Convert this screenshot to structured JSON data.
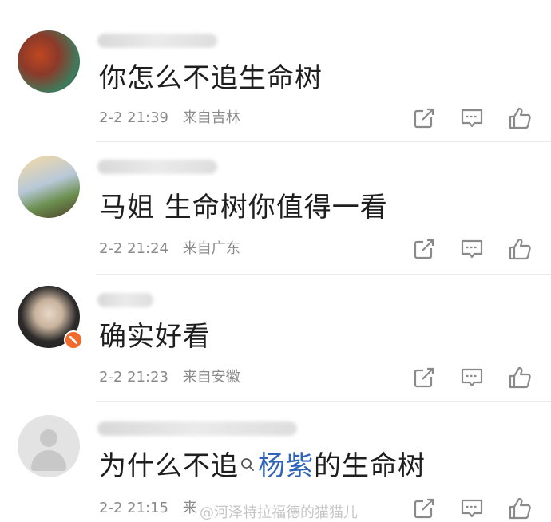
{
  "comments": [
    {
      "text": "你怎么不追生命树",
      "time": "2-2 21:39",
      "location": "来自吉林"
    },
    {
      "text": "马姐 生命树你值得一看",
      "time": "2-2 21:24",
      "location": "来自广东"
    },
    {
      "text": "确实好看",
      "time": "2-2 21:23",
      "location": "来自安徽"
    },
    {
      "text_before": "为什么不追",
      "text_link": "杨紫",
      "text_after": "的生命树",
      "time": "2-2 21:15",
      "location": "来"
    }
  ],
  "watermark": "@河泽特拉福德的猫猫儿",
  "colors": {
    "link": "#2f63b8",
    "meta": "#8a8a8a",
    "icon": "#8a8a8a"
  }
}
